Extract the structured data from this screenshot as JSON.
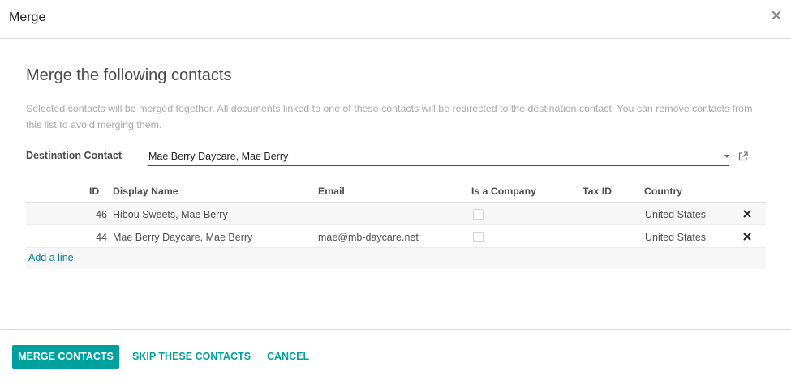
{
  "dialog": {
    "title": "Merge"
  },
  "body": {
    "heading": "Merge the following contacts",
    "help_text": "Selected contacts will be merged together. All documents linked to one of these contacts will be redirected to the destination contact. You can remove contacts from this list to avoid merging them.",
    "destination_label": "Destination Contact",
    "destination_value": "Mae Berry Daycare, Mae Berry"
  },
  "table": {
    "headers": {
      "id": "ID",
      "display_name": "Display Name",
      "email": "Email",
      "is_company": "Is a Company",
      "tax_id": "Tax ID",
      "country": "Country"
    },
    "rows": [
      {
        "id": "46",
        "display_name": "Hibou Sweets, Mae Berry",
        "email": "",
        "is_company": false,
        "tax_id": "",
        "country": "United States"
      },
      {
        "id": "44",
        "display_name": "Mae Berry Daycare, Mae Berry",
        "email": "mae@mb-daycare.net",
        "is_company": false,
        "tax_id": "",
        "country": "United States"
      }
    ],
    "add_line": "Add a line"
  },
  "footer": {
    "merge_label": "MERGE CONTACTS",
    "skip_label": "SKIP THESE CONTACTS",
    "cancel_label": "CANCEL"
  },
  "colors": {
    "primary": "#00a09d",
    "link": "#017e84"
  },
  "icons": {
    "close": "close-icon",
    "external_link": "external-link-icon",
    "caret": "caret-down-icon",
    "delete": "delete-x-icon"
  }
}
